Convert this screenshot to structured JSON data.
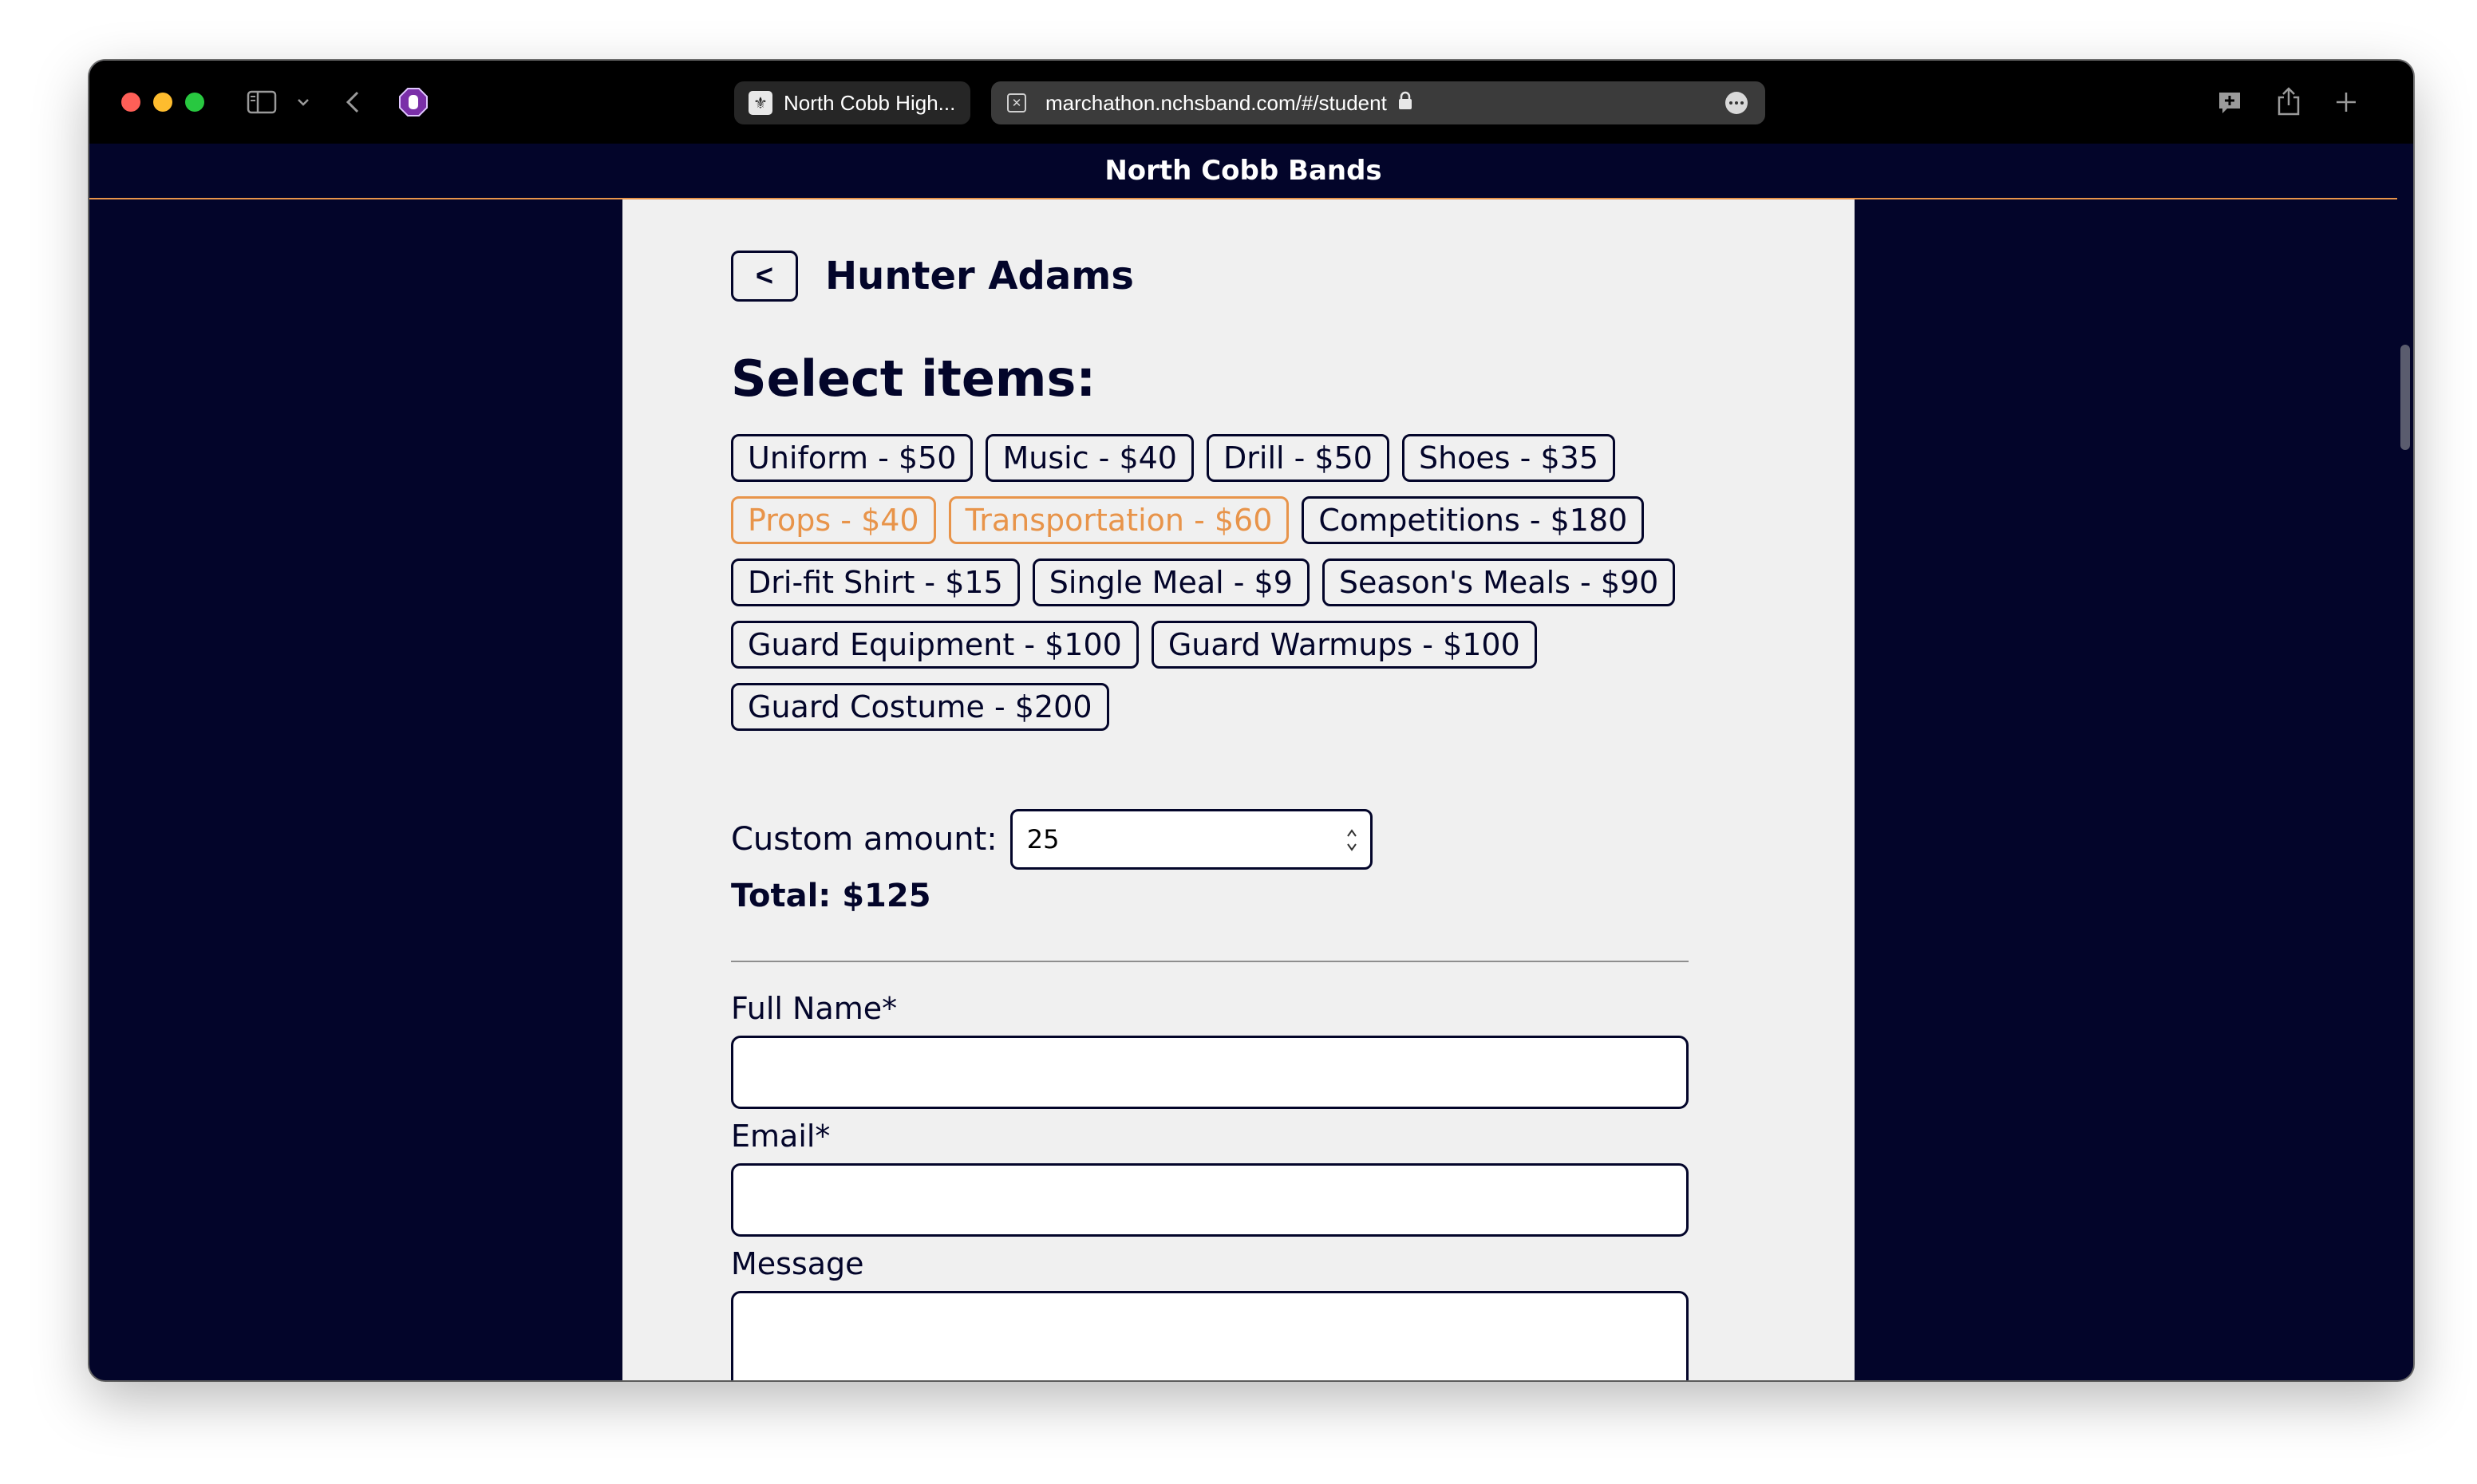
{
  "browser": {
    "tabs": [
      {
        "label": "North Cobb High...",
        "active": false
      },
      {
        "label": "marchathon.nchsband.com/#/student",
        "active": true
      }
    ]
  },
  "site": {
    "header_title": "North Cobb Bands",
    "accent_color": "#e8944a",
    "brand_color": "#03052a"
  },
  "student": {
    "back_label": "<",
    "name": "Hunter Adams"
  },
  "items_heading": "Select items:",
  "items": [
    {
      "label": "Uniform - $50",
      "selected": false
    },
    {
      "label": "Music - $40",
      "selected": false
    },
    {
      "label": "Drill - $50",
      "selected": false
    },
    {
      "label": "Shoes - $35",
      "selected": false
    },
    {
      "label": "Props - $40",
      "selected": true
    },
    {
      "label": "Transportation - $60",
      "selected": true
    },
    {
      "label": "Competitions - $180",
      "selected": false
    },
    {
      "label": "Dri-fit Shirt - $15",
      "selected": false
    },
    {
      "label": "Single Meal - $9",
      "selected": false
    },
    {
      "label": "Season's Meals - $90",
      "selected": false
    },
    {
      "label": "Guard Equipment - $100",
      "selected": false
    },
    {
      "label": "Guard Warmups - $100",
      "selected": false
    },
    {
      "label": "Guard Costume - $200",
      "selected": false
    }
  ],
  "custom_amount": {
    "label": "Custom amount:",
    "value": "25"
  },
  "total": "Total: $125",
  "form": {
    "full_name_label": "Full Name*",
    "email_label": "Email*",
    "message_label": "Message"
  }
}
